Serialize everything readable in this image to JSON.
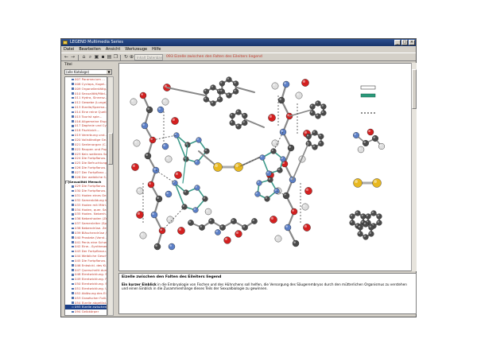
{
  "window": {
    "title": "LEGEND Multimedia Series",
    "buttons": [
      "_",
      "□",
      "×"
    ]
  },
  "menu": [
    "Datei",
    "Bearbeiten",
    "Ansicht",
    "Werkzeuge",
    "Hilfe"
  ],
  "toolbar": {
    "back_icon": "back-arrow-icon",
    "forward_icon": "forward-arrow-icon",
    "field_placeholder": "Inhalt Datenbank",
    "current_title": "093 Eizelle zwischen den Falten des Eileiters liegend"
  },
  "sidebar": {
    "label": "Titel",
    "select_value": "(alle Kataloge)",
    "items": [
      {
        "label": "007 Paramecium …",
        "type": "item"
      },
      {
        "label": "008 Cyclops, Kugel…",
        "type": "item"
      },
      {
        "label": "009 Organellentätig…",
        "type": "item"
      },
      {
        "label": "010 Sexualität/Mäd…",
        "type": "item"
      },
      {
        "label": "011 Hydra, Sinnesz…",
        "type": "item"
      },
      {
        "label": "012 Gewebe (Lunge)…",
        "type": "item"
      },
      {
        "label": "013 Eizelle/Sperma…",
        "type": "item"
      },
      {
        "label": "014 Eine reine Quelle…",
        "type": "item"
      },
      {
        "label": "015 Tourist spie…",
        "type": "item"
      },
      {
        "label": "016 Allgemeine Eisp…",
        "type": "item"
      },
      {
        "label": "017 Daphnie und Cy…",
        "type": "item"
      },
      {
        "label": "018 Fischlaich…",
        "type": "item"
      },
      {
        "label": "019 Vererbung und…",
        "type": "item"
      },
      {
        "label": "020 Vollständige Ge…",
        "type": "item"
      },
      {
        "label": "021 Seelenorgan (C…",
        "type": "item"
      },
      {
        "label": "022 Raupen und Pupp…",
        "type": "item"
      },
      {
        "label": "023 Kein weiteres So…",
        "type": "item"
      },
      {
        "label": "024 Die Fortpflanzu…",
        "type": "item"
      },
      {
        "label": "025 Die Befruchtung…",
        "type": "item"
      },
      {
        "label": "026 Die Fortpflanzu…",
        "type": "item"
      },
      {
        "label": "027 Der Fortpflanz…",
        "type": "item"
      },
      {
        "label": "028 Der weibliche S…",
        "type": "item"
      },
      {
        "label": "Sexualität Mensch",
        "type": "group"
      },
      {
        "label": "029 Die Fortpflanzu…",
        "type": "item"
      },
      {
        "label": "030 Die Fortpflanzu…",
        "type": "item"
      },
      {
        "label": "031 Hoden eines Ge…",
        "type": "item"
      },
      {
        "label": "032 Samenbildung in…",
        "type": "item"
      },
      {
        "label": "033 Hoden mit Mitri…",
        "type": "item"
      },
      {
        "label": "034 Hoden, quer. Sa…",
        "type": "item"
      },
      {
        "label": "035 Hoden. Nebenh…",
        "type": "item"
      },
      {
        "label": "036 Nebenhoden (Ze…",
        "type": "item"
      },
      {
        "label": "037 Samenleiter (Sp…",
        "type": "item"
      },
      {
        "label": "038 Nebendrüse. Ze…",
        "type": "item"
      },
      {
        "label": "039 Bläschendrüse /…",
        "type": "item"
      },
      {
        "label": "040 Prostata (Vorst…",
        "type": "item"
      },
      {
        "label": "041 Penis eine Schw…",
        "type": "item"
      },
      {
        "label": "042 Eine…Synthesen…",
        "type": "item"
      },
      {
        "label": "043 Der Fortpflanzu…",
        "type": "item"
      },
      {
        "label": "044 Weibliche Gesch…",
        "type": "item"
      },
      {
        "label": "045 Die Fortpflanzu…",
        "type": "item"
      },
      {
        "label": "046 Entwickl. des Ki…",
        "type": "item"
      },
      {
        "label": "047 Querschnitt durc…",
        "type": "item"
      },
      {
        "label": "048 Eientwicklung. S…",
        "type": "item"
      },
      {
        "label": "049 Eientwicklung. F…",
        "type": "item"
      },
      {
        "label": "050 Eientwicklung. S…",
        "type": "item"
      },
      {
        "label": "051 Eientwicklung. U…",
        "type": "item"
      },
      {
        "label": "052 Ablösung des Ei…",
        "type": "item"
      },
      {
        "label": "053 Graafscher Folli…",
        "type": "item"
      },
      {
        "label": "054 Eizelle abgelöst…",
        "type": "item"
      },
      {
        "label": "093 Eizelle zwischen…",
        "type": "selected"
      },
      {
        "label": "094 Gelbkörper",
        "type": "item"
      }
    ]
  },
  "text_panel": {
    "title": "Eizelle zwischen den Falten des Eileiters liegend",
    "bold_lead": "Ein kurzer Einblick",
    "body": "in die Embryologie von Fischen und des Hühnchens soll helfen, die Versorgung des Säugerembryos durch den mütterlichen Organismus zu verstehen und einen Einblick in die Zusammenhänge dieses Teils der Sexualbiologie zu gewinnen."
  },
  "colors": {
    "carbon": "#4a4a4a",
    "oxygen": "#d42020",
    "nitrogen": "#5b7fc7",
    "hydrogen": "#dedede",
    "sulfur": "#e8b820",
    "bond": "#3c9a8a",
    "legend_green": "#2a9a7a",
    "accent_red": "#c0392b"
  }
}
